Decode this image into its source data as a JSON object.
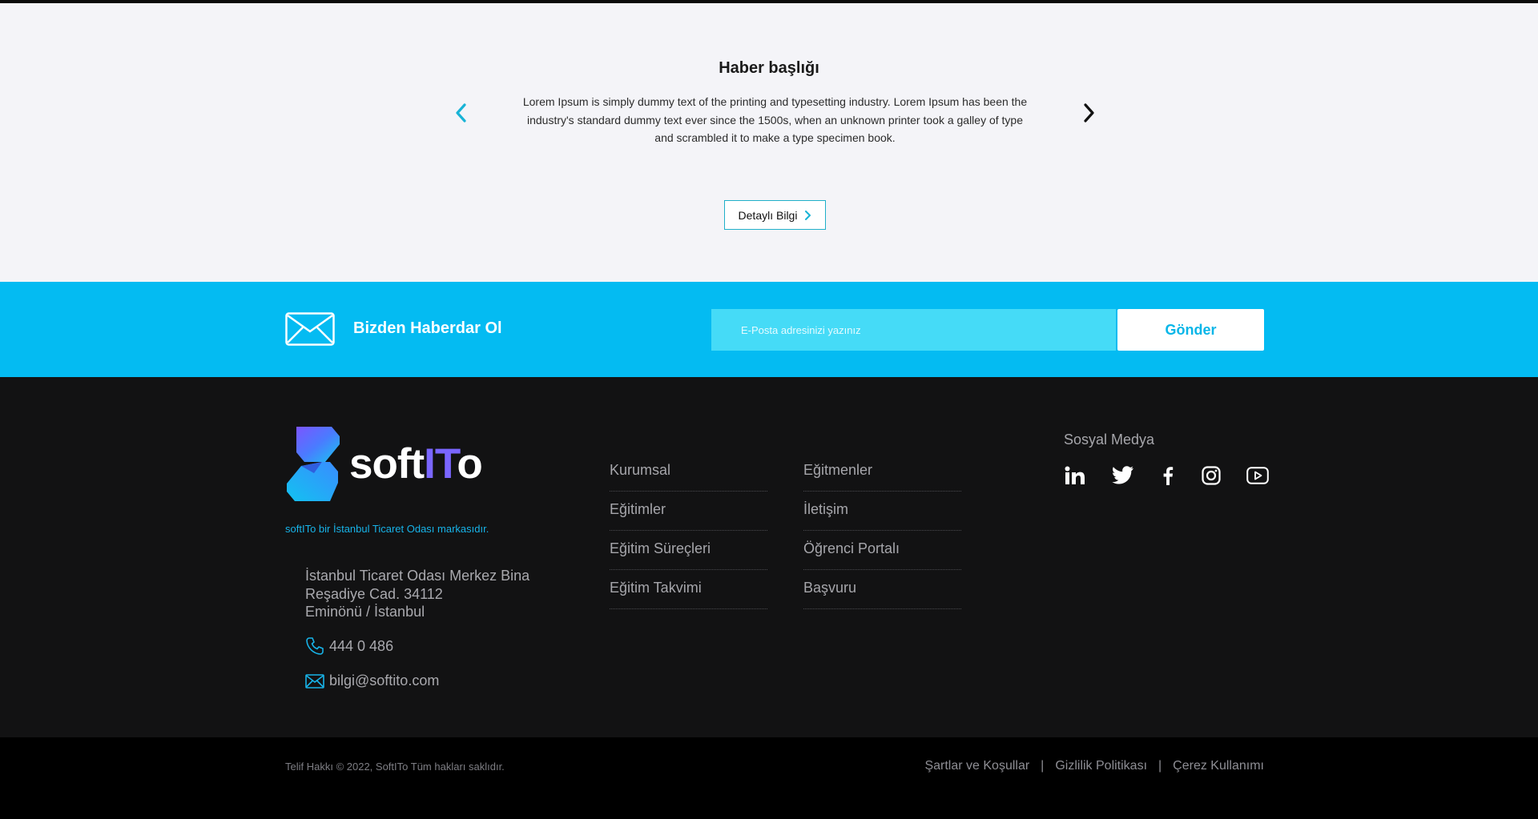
{
  "news": {
    "title": "Haber başlığı",
    "body": "Lorem Ipsum is simply dummy text of the printing and typesetting industry. Lorem Ipsum has been the industry's standard dummy text ever since the 1500s, when an unknown printer took a galley of type and scrambled it to make a type specimen book.",
    "details_label": "Detaylı Bilgi"
  },
  "newsletter": {
    "title": "Bizden Haberdar Ol",
    "placeholder": "E-Posta adresinizi yazınız",
    "send_label": "Gönder"
  },
  "footer": {
    "logo_text_a": "soft",
    "logo_text_it": "IT",
    "logo_text_b": "o",
    "chamber_note": "softITo bir İstanbul Ticaret Odası markasıdır.",
    "address_lines": [
      "İstanbul Ticaret Odası Merkez Bina",
      "Reşadiye Cad. 34112",
      "Eminönü / İstanbul"
    ],
    "phone": "444 0 486",
    "email": "bilgi@softito.com",
    "links_col1": [
      "Kurumsal",
      "Eğitimler",
      "Eğitim Süreçleri",
      "Eğitim Takvimi"
    ],
    "links_col2": [
      "Eğitmenler",
      "İletişim",
      "Öğrenci Portalı",
      "Başvuru"
    ],
    "social_title": "Sosyal Medya",
    "social_icons": [
      "linkedin-icon",
      "twitter-icon",
      "facebook-icon",
      "instagram-icon",
      "youtube-icon"
    ]
  },
  "bottom": {
    "copyright": "Telif Hakkı © 2022, SoftITo Tüm hakları saklıdır.",
    "legal_links": [
      "Şartlar ve Koşullar",
      "Gizlilik Politikası",
      "Çerez Kullanımı"
    ],
    "separator": "|"
  },
  "colors": {
    "accent": "#04bbf2",
    "footer_bg": "#121213",
    "bottom_bg": "#000000"
  }
}
